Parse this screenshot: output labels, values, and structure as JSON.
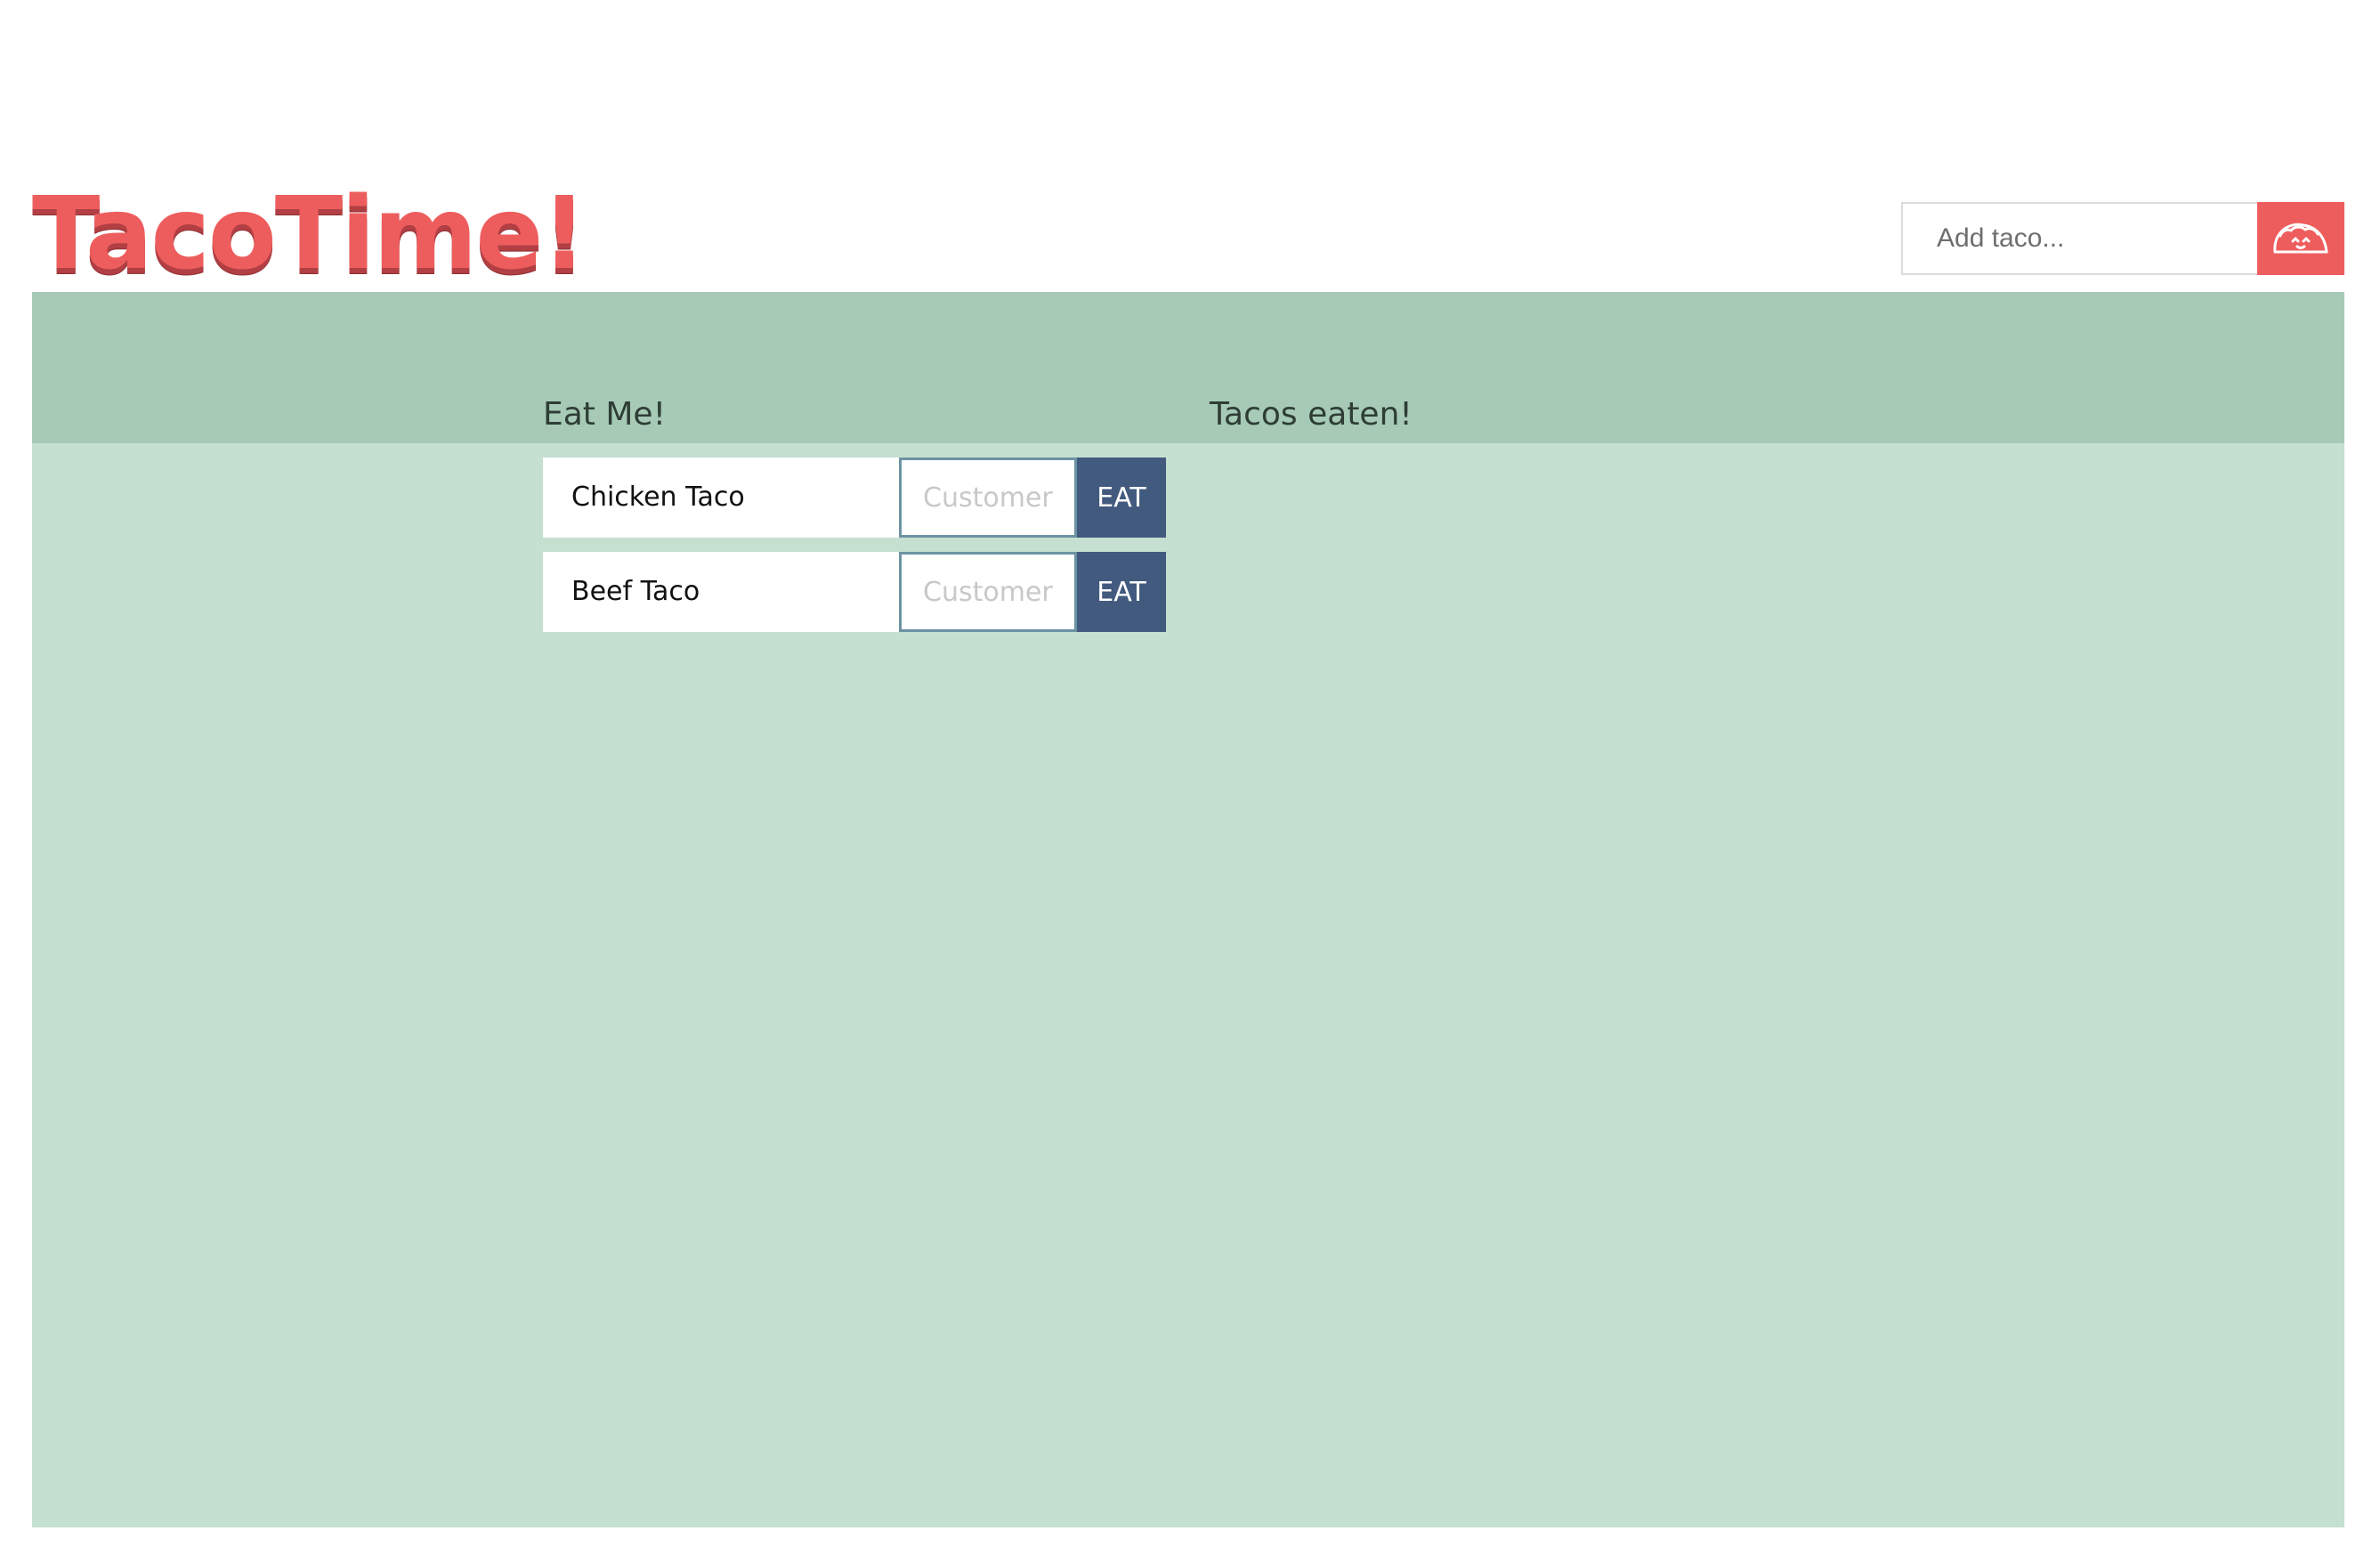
{
  "header": {
    "logo": "TacoTime!",
    "add_taco": {
      "placeholder": "Add taco...",
      "button_icon": "taco-icon"
    }
  },
  "columns": {
    "to_eat_title": "Eat Me!",
    "eaten_title": "Tacos eaten!"
  },
  "tacos": [
    {
      "name": "Chicken Taco",
      "customer_placeholder": "Customer",
      "button_label": "EAT"
    },
    {
      "name": "Beef Taco",
      "customer_placeholder": "Customer",
      "button_label": "EAT"
    }
  ],
  "eaten": [],
  "colors": {
    "brand": "#ee5d5d",
    "band": "#a6cab6",
    "panel": "#c5dfd1",
    "eat_button": "#435a7f",
    "input_border": "#6c93a3"
  }
}
